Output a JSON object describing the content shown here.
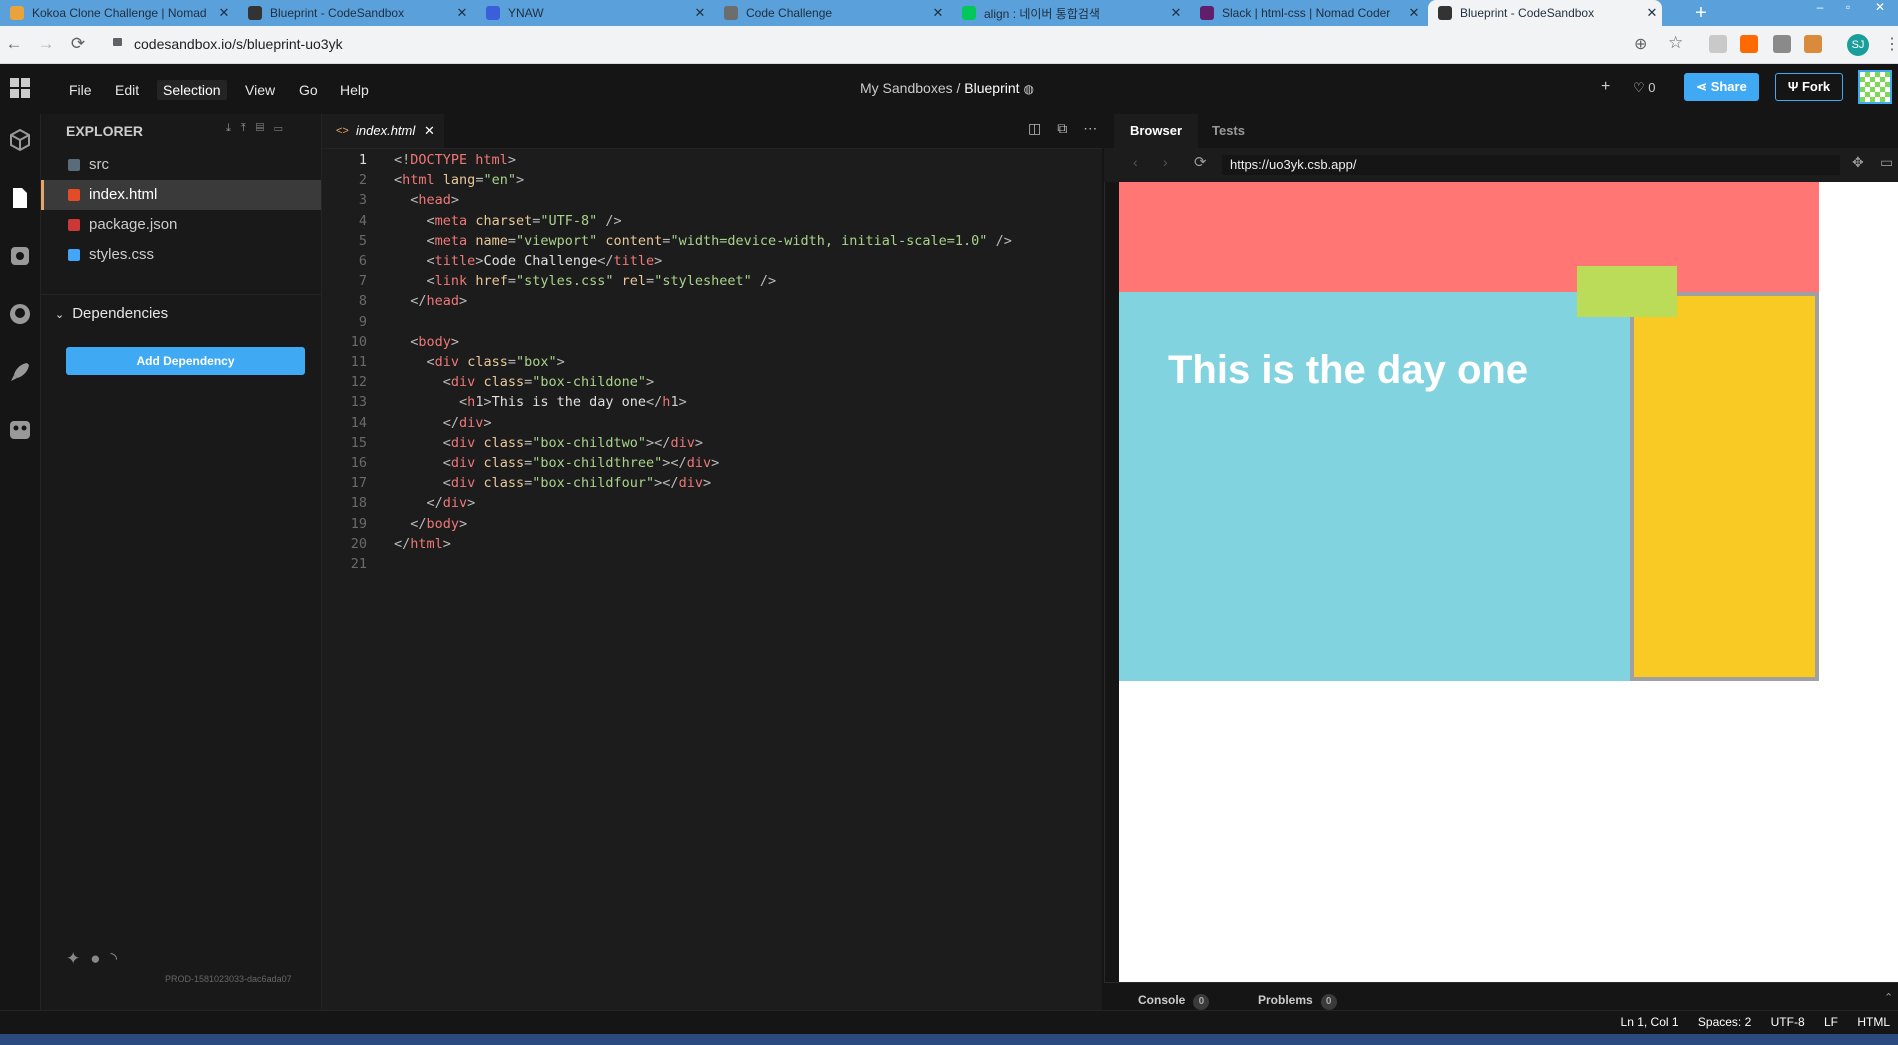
{
  "chrome": {
    "tabs": [
      {
        "title": "Kokoa Clone Challenge | Nomad",
        "favicon_color": "#e8a33c"
      },
      {
        "title": "Blueprint - CodeSandbox",
        "favicon_color": "#333333"
      },
      {
        "title": "YNAW",
        "favicon_color": "#3b5fd9"
      },
      {
        "title": "Code Challenge",
        "favicon_color": "#6d6d6d"
      },
      {
        "title": "align : 네이버 통합검색",
        "favicon_color": "#03c75a"
      },
      {
        "title": "Slack | html-css | Nomad Coder",
        "favicon_color": "#611f69"
      },
      {
        "title": "Blueprint - CodeSandbox",
        "favicon_color": "#333333",
        "active": true
      }
    ],
    "url": "codesandbox.io/s/blueprint-uo3yk",
    "profile_initials": "SJ"
  },
  "app": {
    "menu": [
      "File",
      "Edit",
      "Selection",
      "View",
      "Go",
      "Help"
    ],
    "selected_menu": "Selection",
    "breadcrumb_prefix": "My Sandboxes /",
    "sandbox_name": "Blueprint",
    "likes": "0",
    "share_label": "Share",
    "fork_label": "Fork"
  },
  "sidebar": {
    "title": "EXPLORER",
    "files": [
      {
        "name": "src",
        "icon": "folder-icon",
        "color": "#5a6b7a"
      },
      {
        "name": "index.html",
        "icon": "html-file-icon",
        "color": "#e34c26",
        "active": true
      },
      {
        "name": "package.json",
        "icon": "json-file-icon",
        "color": "#cb3837"
      },
      {
        "name": "styles.css",
        "icon": "css-file-icon",
        "color": "#42a5f5"
      }
    ],
    "dependencies_label": "Dependencies",
    "add_dependency_label": "Add Dependency",
    "build_id": "PROD-1581023033-dac6ada07"
  },
  "editor": {
    "tab_label": "index.html",
    "current_line": 1,
    "lines": [
      "<!DOCTYPE html>",
      "<html lang=\"en\">",
      "  <head>",
      "    <meta charset=\"UTF-8\" />",
      "    <meta name=\"viewport\" content=\"width=device-width, initial-scale=1.0\" />",
      "    <title>Code Challenge</title>",
      "    <link href=\"styles.css\" rel=\"stylesheet\" />",
      "  </head>",
      "",
      "  <body>",
      "    <div class=\"box\">",
      "      <div class=\"box-childone\">",
      "        <h1>This is the day one</h1>",
      "      </div>",
      "      <div class=\"box-childtwo\"></div>",
      "      <div class=\"box-childthree\"></div>",
      "      <div class=\"box-childfour\"></div>",
      "    </div>",
      "  </body>",
      "</html>",
      ""
    ]
  },
  "browser": {
    "tabs": [
      "Browser",
      "Tests"
    ],
    "active_tab": "Browser",
    "url": "https://uo3yk.csb.app/",
    "preview_heading": "This is the day one",
    "colors": {
      "top": "#ff7675",
      "main": "#81d3df",
      "small": "#badc58",
      "side": "#f9ca24"
    },
    "console_label": "Console",
    "console_count": "0",
    "problems_label": "Problems",
    "problems_count": "0"
  },
  "status": {
    "position": "Ln 1, Col 1",
    "spaces": "Spaces: 2",
    "encoding": "UTF-8",
    "eol": "LF",
    "language": "HTML"
  }
}
